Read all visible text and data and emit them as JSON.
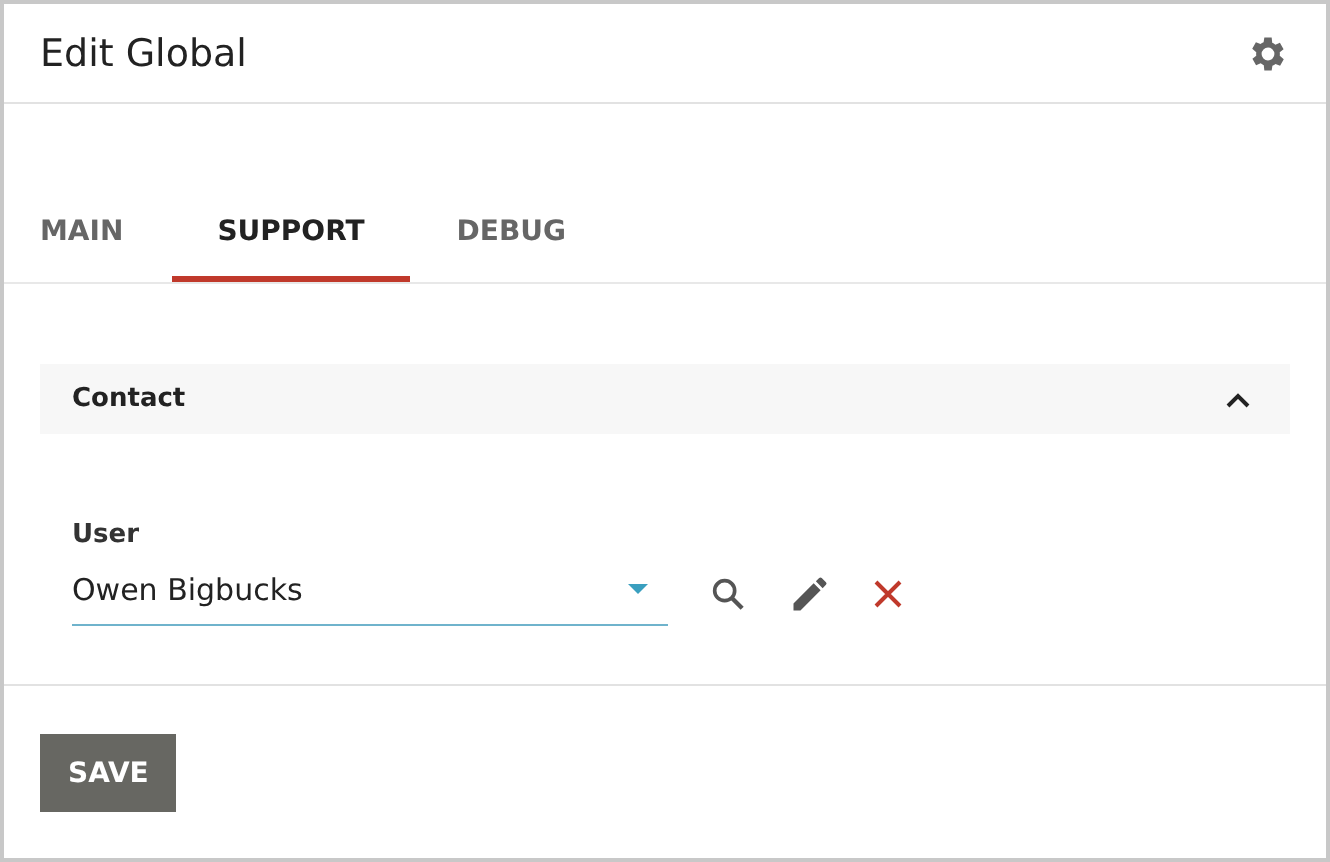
{
  "window": {
    "title": "Edit Global"
  },
  "tabs": [
    {
      "label": "MAIN",
      "selected": false
    },
    {
      "label": "SUPPORT",
      "selected": true
    },
    {
      "label": "DEBUG",
      "selected": false
    }
  ],
  "section": {
    "title": "Contact",
    "expanded": true
  },
  "field": {
    "label": "User",
    "value": "Owen Bigbucks"
  },
  "buttons": [
    "SAVE"
  ]
}
